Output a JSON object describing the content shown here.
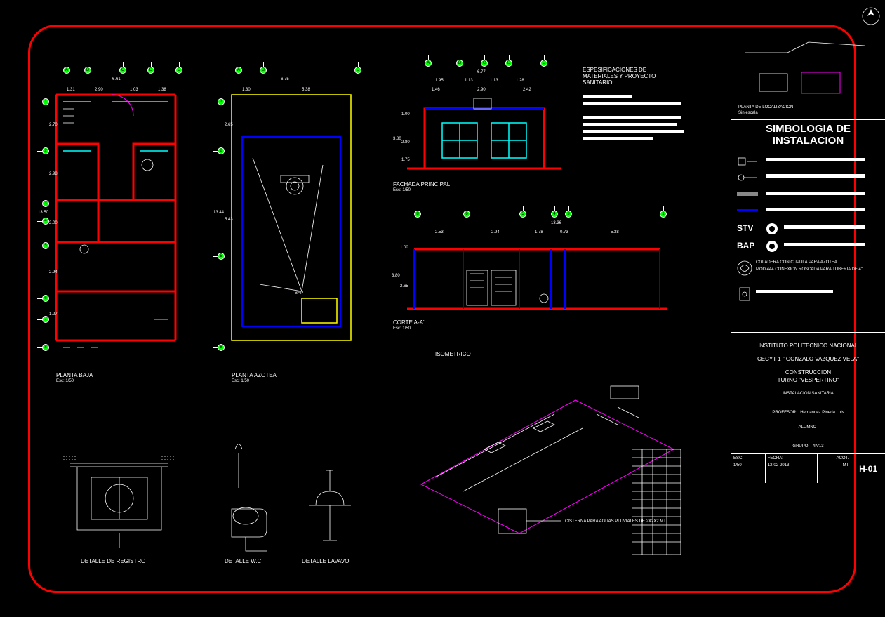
{
  "views": {
    "planta_baja": {
      "title": "PLANTA BAJA",
      "scale": "Esc: 1/50"
    },
    "planta_azotea": {
      "title": "PLANTA AZOTEA",
      "scale": "Esc: 1/50"
    },
    "fachada": {
      "title": "FACHADA PRINCIPAL",
      "scale": "Esc: 1/50"
    },
    "corte": {
      "title": "CORTE A-A'",
      "scale": "Esc: 1/50"
    },
    "isometrico": {
      "title": "ISOMETRICO"
    },
    "registro": {
      "title": "DETALLE DE REGISTRO"
    },
    "wc": {
      "title": "DETALLE W.C."
    },
    "lavabo": {
      "title": "DETALLE LAVAVO"
    },
    "localizacion": {
      "title": "PLANTA DE LOCALIZACION",
      "scale": "Sin escala"
    }
  },
  "specs_heading": "ESPESIFICACIONES DE MATERIALES Y PROYECTO SANITARIO",
  "simbologia": {
    "heading": "SIMBOLOGIA DE INSTALACION",
    "stv": "STV",
    "bap": "BAP",
    "coladera": "COLADERA CON CUPULA PARA AZOTEA",
    "conexion": "MOD.444 CONEXION ROSCADA PARA TUBERIA DE 4\""
  },
  "dims": {
    "pb_top_total": "6.61",
    "pb_top": [
      "1.31",
      "2.90",
      "1.03",
      "1.38"
    ],
    "pb_left": [
      "2.70",
      "2.98",
      "2.00",
      "2.94",
      "1.27"
    ],
    "pb_left_total": "13.50",
    "az_top_total": "6.75",
    "az_top": [
      "1.30",
      "5.38"
    ],
    "az_left": [
      "2.65",
      "5.43"
    ],
    "az_left_total": "13.44",
    "bap_label": "BAP",
    "fach_top_total": "6.77",
    "fach_top": [
      "1.95",
      "1.13",
      "1.13",
      "1.28"
    ],
    "fach_top2": [
      "1.46",
      "2.90",
      "2.42"
    ],
    "fach_left": [
      "1.00",
      "2.80",
      "1.75"
    ],
    "fach_left_total": "3.80",
    "corte_top_total": "13.36",
    "corte_top": [
      "2.53",
      "2.94",
      "1.78",
      "0.73",
      "5.38"
    ],
    "corte_left": [
      "1.00",
      "2.65"
    ],
    "corte_left_total": "3.80",
    "cisterna": "CISTERNA PARA AGUAS PLUVIALES DE 2X2X2 MT"
  },
  "grid_letters": [
    "A",
    "B",
    "C",
    "D",
    "E"
  ],
  "grid_nums": [
    "1",
    "2",
    "3",
    "4",
    "5",
    "6",
    "7",
    "8"
  ],
  "titleblock": {
    "inst": "INSTITUTO POLITECNICO NACIONAL",
    "school": "CECYT 1 \" GONZALO VAZQUEZ VELA\"",
    "dept": "CONSTRUCCION",
    "turno": "TURNO \"VESPERTINO\"",
    "drawing": "INSTALACION SANITARIA",
    "prof_label": "PROFESOR:",
    "prof": "Hernandez Pineda Luis",
    "alumno_label": "ALUMNO-",
    "grupo_label": "GRUPO-",
    "grupo": "4IV13",
    "esc_label": "ESC:",
    "esc": "1/50",
    "fecha_label": "FECHA:",
    "fecha": "12-02-2013",
    "acot_label": "ACOT.",
    "acot": "MT",
    "sheet": "H-01"
  }
}
